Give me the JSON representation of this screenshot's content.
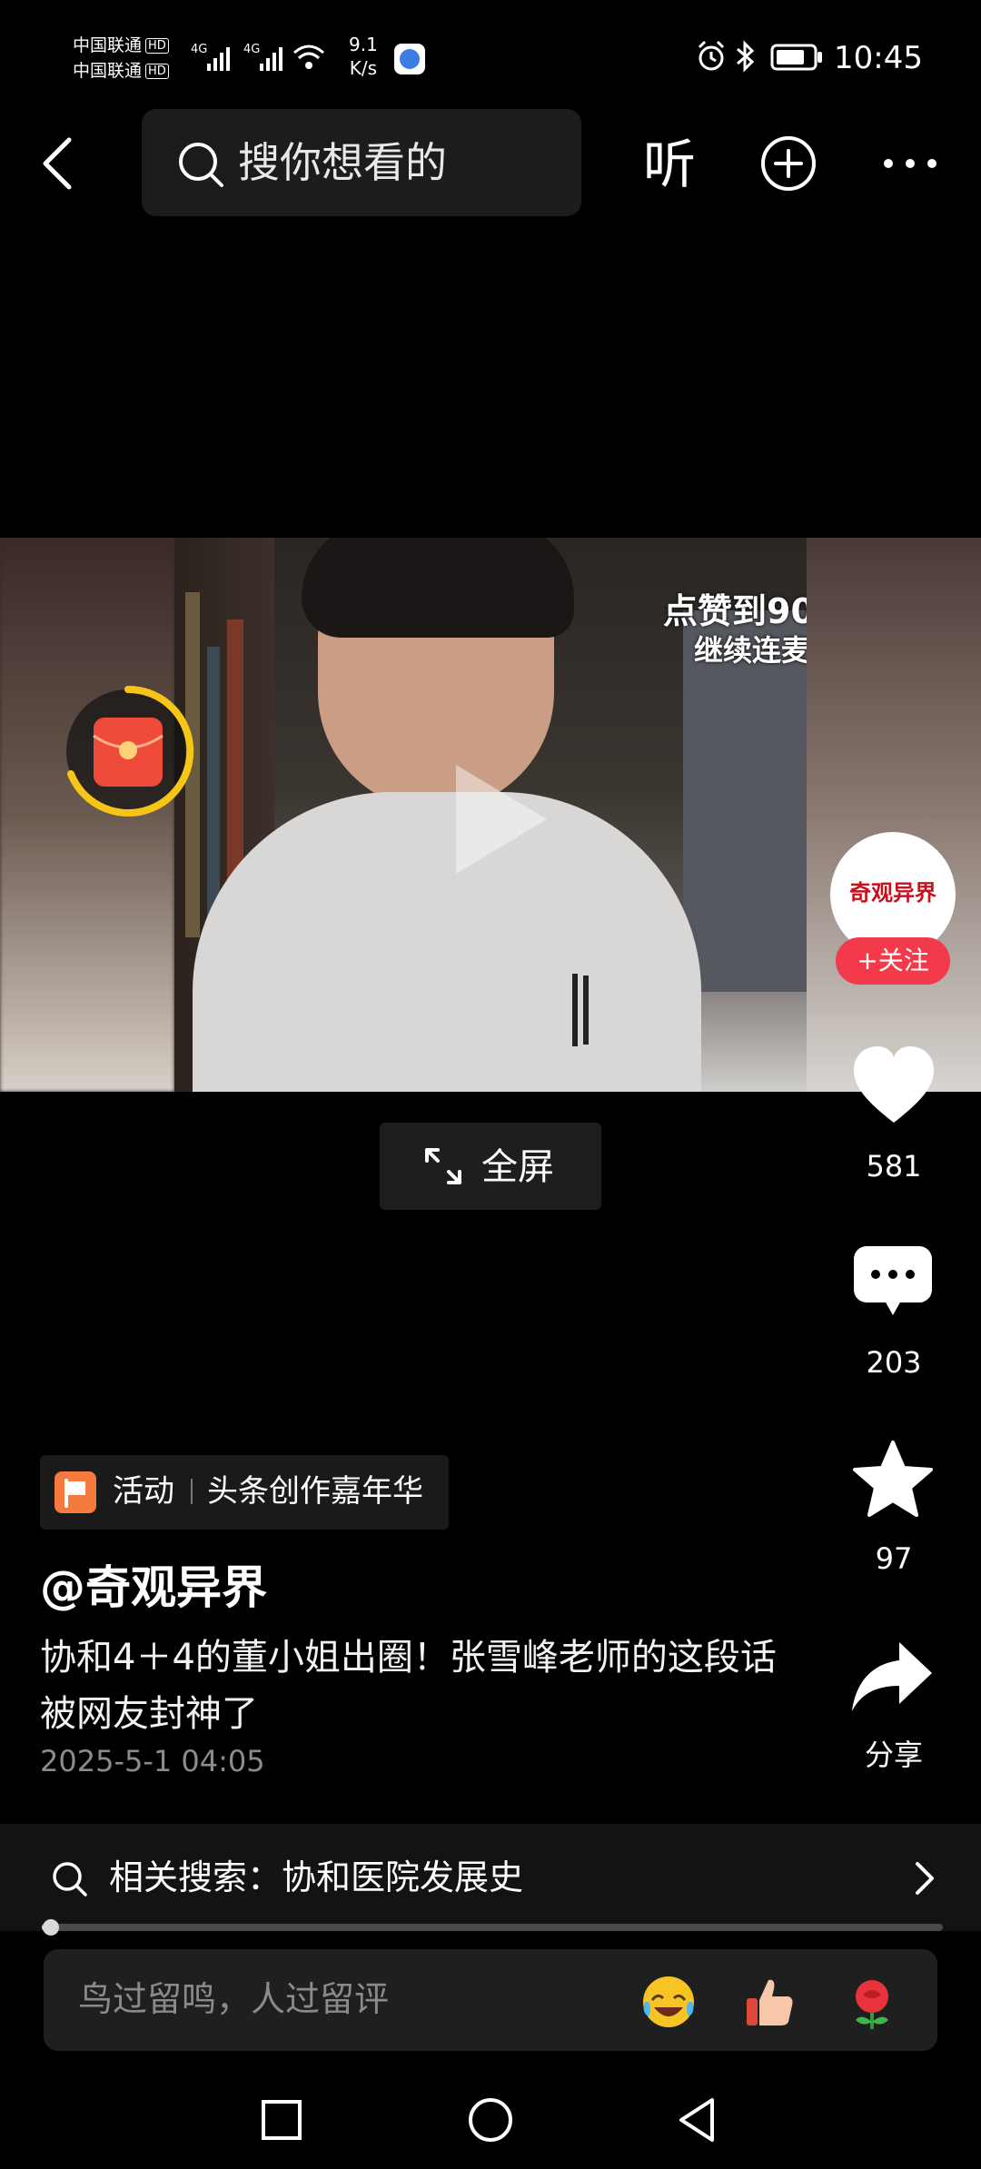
{
  "status_bar": {
    "carrier_1": "中国联通",
    "carrier_2": "中国联通",
    "hd": "HD",
    "net_speed_value": "9.1",
    "net_speed_unit": "K/s",
    "time": "10:45"
  },
  "top_bar": {
    "search_placeholder": "搜你想看的",
    "listen_label": "听"
  },
  "video": {
    "overlay_line1": "点赞到90",
    "overlay_line2": "继续连麦"
  },
  "rail": {
    "avatar_text": "奇观异界",
    "follow_label": "+关注",
    "likes": "581",
    "comments": "203",
    "favorites": "97",
    "share_label": "分享"
  },
  "fullscreen_label": "全屏",
  "activity": {
    "tag": "活动",
    "name": "头条创作嘉年华"
  },
  "post": {
    "author": "@奇观异界",
    "description": "协和4＋4的董小姐出圈！张雪峰老师的这段话被网友封神了",
    "timestamp": "2025-5-1 04:05"
  },
  "related_search": {
    "label": "相关搜索：协和医院发展史"
  },
  "playback": {
    "progress_fraction": 0.01
  },
  "comment_bar": {
    "placeholder": "鸟过留鸣，人过留评",
    "emojis": [
      "laughing-tears-emoji",
      "thumbs-up-emoji",
      "rose-emoji"
    ]
  },
  "colors": {
    "accent_red": "#f23a4a",
    "red_packet_ring": "#f5c518",
    "activity_flag": "#f47a3e"
  }
}
